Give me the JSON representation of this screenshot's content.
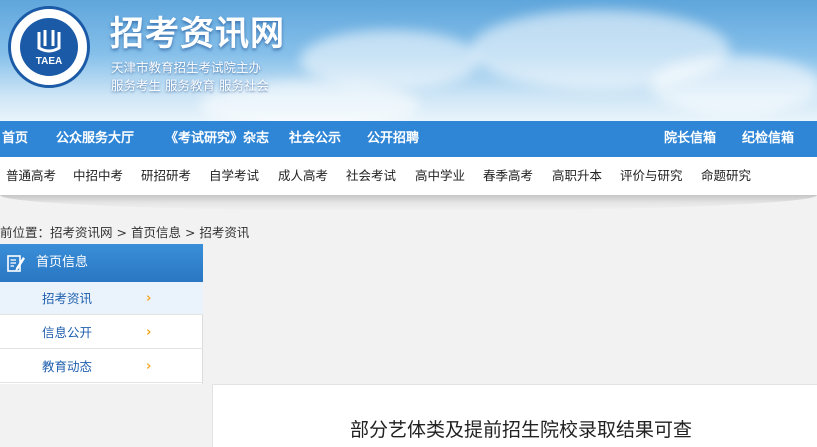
{
  "header": {
    "logo_text": "TAEA",
    "site_title": "招考资讯网",
    "subtitle_1": "天津市教育招生考试院主办",
    "subtitle_2": "服务考生 服务教育 服务社会"
  },
  "main_nav": {
    "items": [
      {
        "label": "首页"
      },
      {
        "label": "公众服务大厅"
      },
      {
        "label": "《考试研究》杂志"
      },
      {
        "label": "社会公示"
      },
      {
        "label": "公开招聘"
      },
      {
        "label": "院长信箱"
      },
      {
        "label": "纪检信箱"
      }
    ]
  },
  "sub_nav": {
    "items": [
      {
        "label": "普通高考"
      },
      {
        "label": "中招中考"
      },
      {
        "label": "研招研考"
      },
      {
        "label": "自学考试"
      },
      {
        "label": "成人高考"
      },
      {
        "label": "社会考试"
      },
      {
        "label": "高中学业"
      },
      {
        "label": "春季高考"
      },
      {
        "label": "高职升本"
      },
      {
        "label": "评价与研究"
      },
      {
        "label": "命题研究"
      }
    ]
  },
  "breadcrumb": {
    "prefix": "前位置：",
    "crumbs": [
      "招考资讯网",
      "首页信息",
      "招考资讯"
    ],
    "separator": " > "
  },
  "sidebar": {
    "title": "首页信息",
    "icon": "edit-note-icon",
    "items": [
      {
        "label": "招考资讯",
        "active": true
      },
      {
        "label": "信息公开",
        "active": false
      },
      {
        "label": "教育动态",
        "active": false
      }
    ],
    "arrow": "›"
  },
  "article": {
    "title": "部分艺体类及提前招生院校录取结果可查"
  },
  "colors": {
    "main_nav_bg": "#2f86d6",
    "sidebar_head_bg": "#2a76c2",
    "sidebar_link": "#1f5fae",
    "arrow": "#f5a623"
  }
}
